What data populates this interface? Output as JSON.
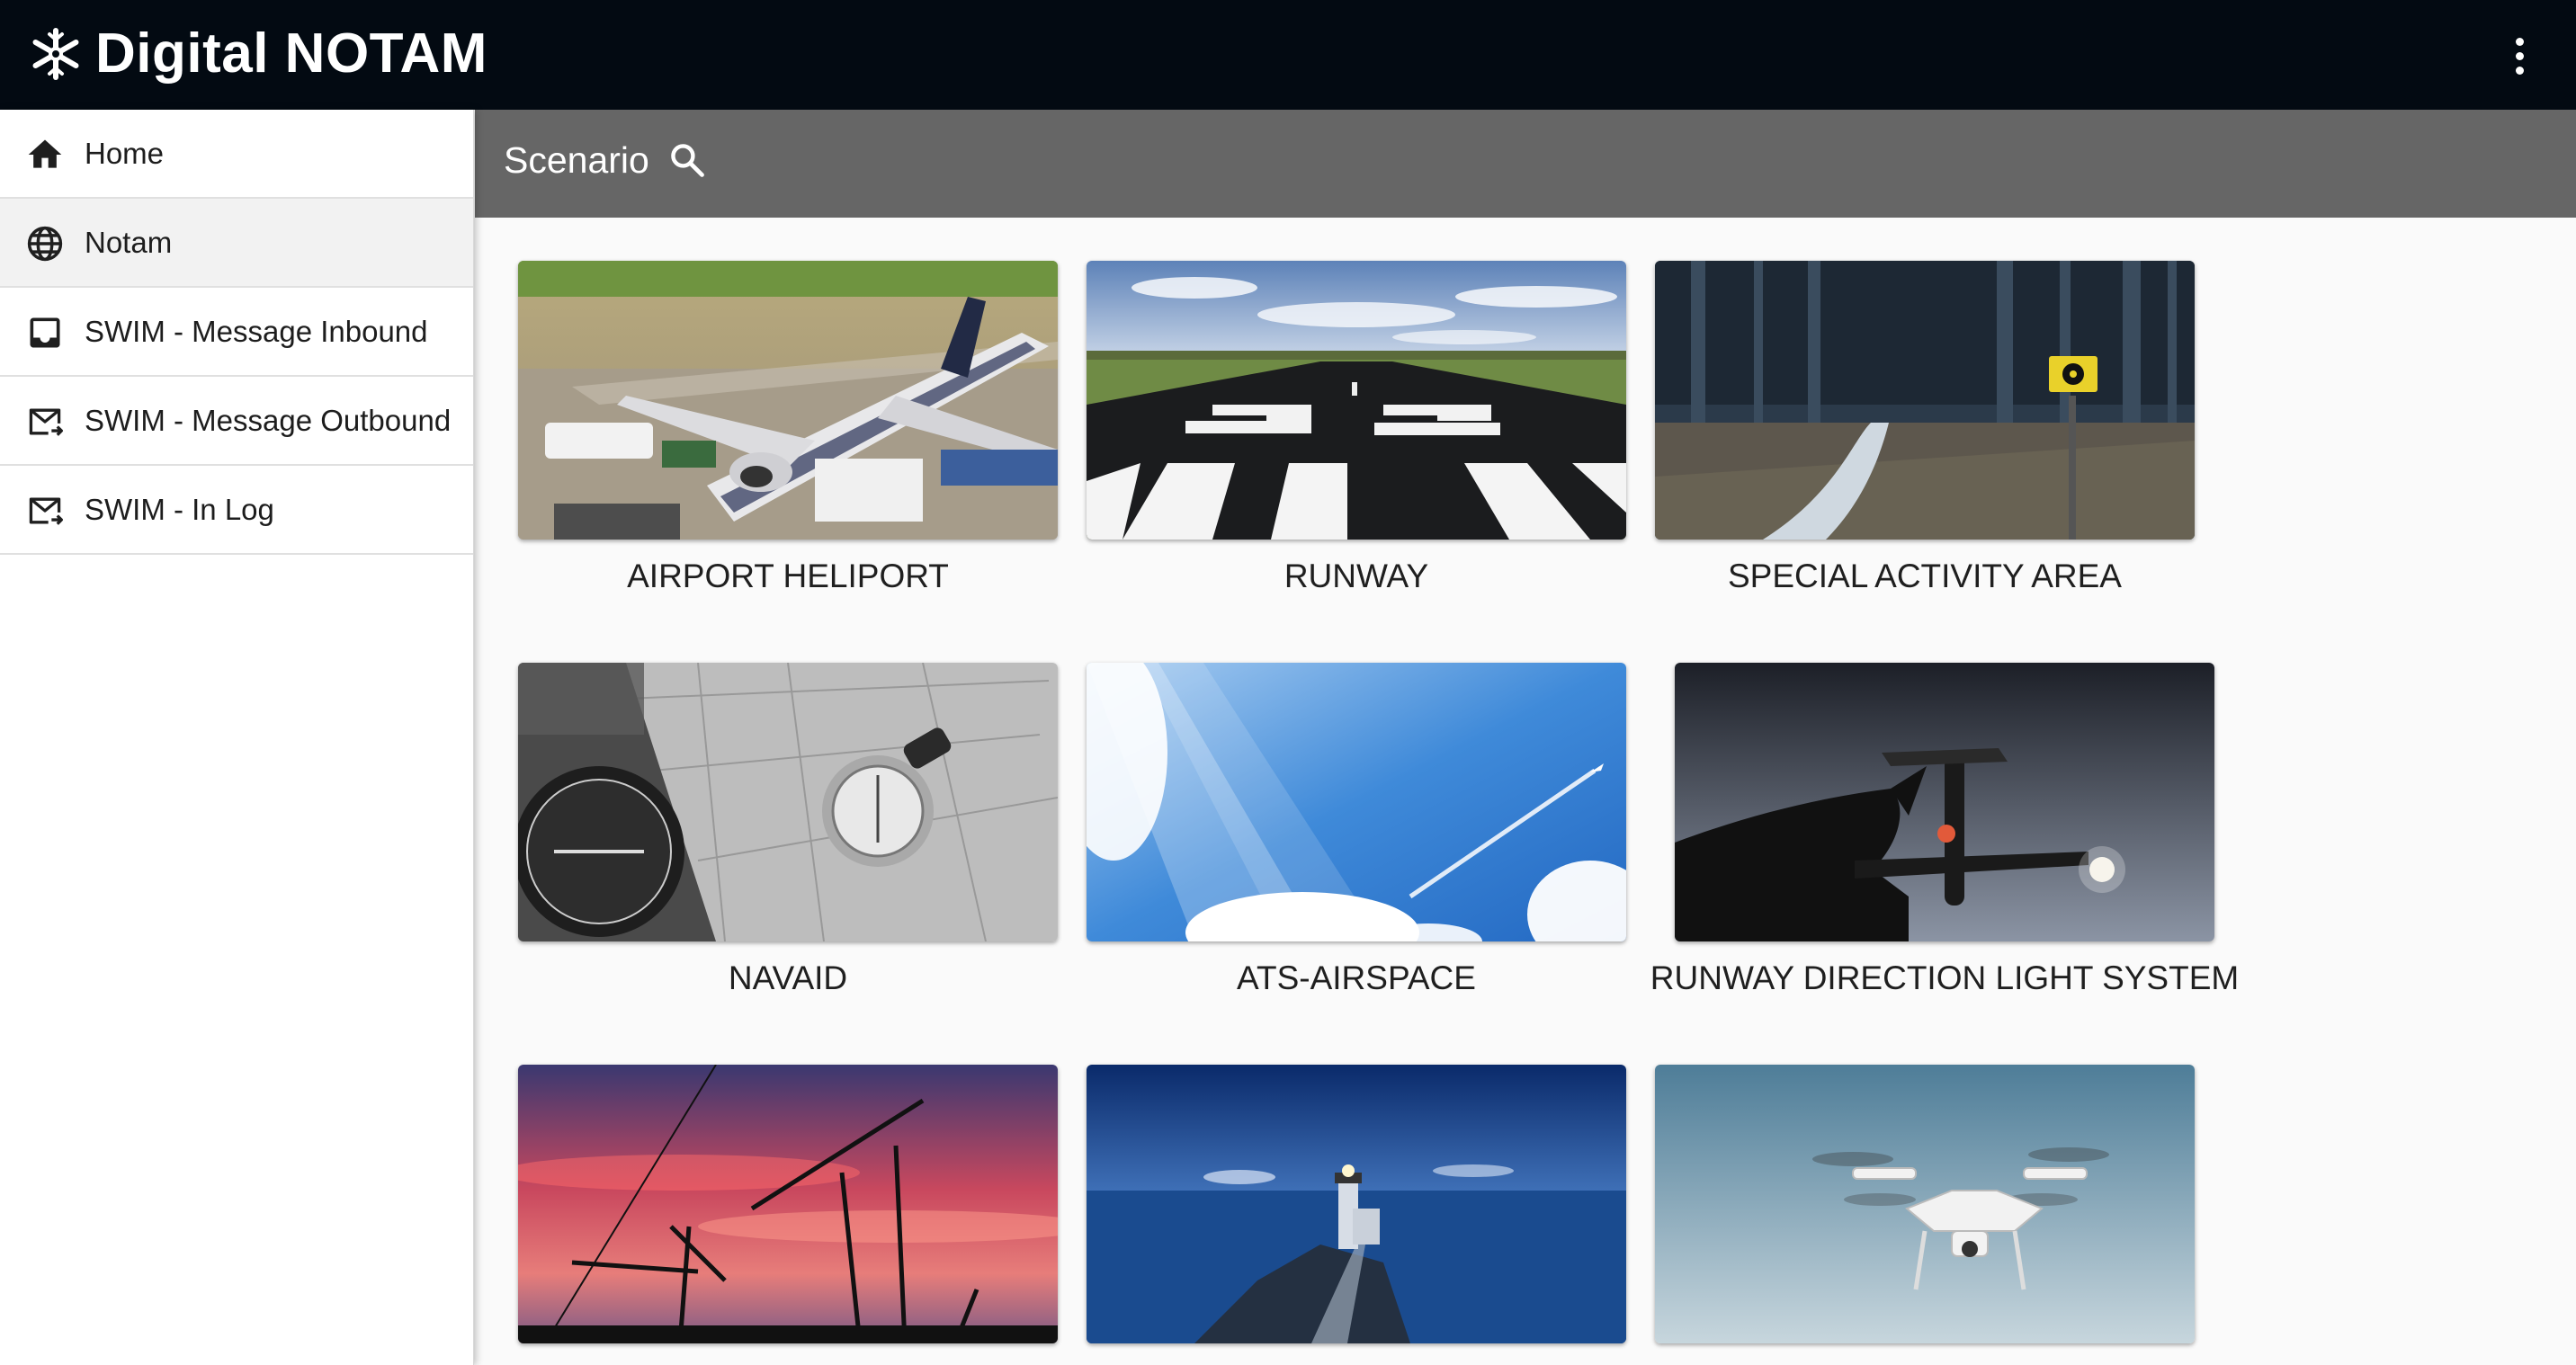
{
  "header": {
    "app_title": "Digital NOTAM",
    "logo_icon": "snowflake-logo-icon",
    "menu_icon": "more-vertical-icon",
    "background_color": "#030a12"
  },
  "sidebar": {
    "items": [
      {
        "label": "Home",
        "icon": "home-icon",
        "active": false
      },
      {
        "label": "Notam",
        "icon": "globe-icon",
        "active": true
      },
      {
        "label": "SWIM - Message Inbound",
        "icon": "inbox-icon",
        "active": false
      },
      {
        "label": "SWIM - Message Outbound",
        "icon": "mail-outbound-icon",
        "active": false
      },
      {
        "label": "SWIM - In Log",
        "icon": "mail-log-icon",
        "active": false
      }
    ]
  },
  "scenario": {
    "title": "Scenario",
    "search_icon": "search-icon",
    "bar_color": "#666666"
  },
  "cards": [
    {
      "label": "AIRPORT HELIPORT",
      "image": "airplane-at-gate-photo"
    },
    {
      "label": "RUNWAY",
      "image": "runway-markings-photo"
    },
    {
      "label": "SPECIAL ACTIVITY AREA",
      "image": "forest-road-radiation-sign-photo"
    },
    {
      "label": "NAVAID",
      "image": "compass-on-map-photo"
    },
    {
      "label": "ATS-AIRSPACE",
      "image": "blue-sky-contrail-photo"
    },
    {
      "label": "RUNWAY DIRECTION LIGHT SYSTEM",
      "image": "hand-airplane-silhouette-photo"
    },
    {
      "label": "",
      "image": "construction-cranes-sunset-photo"
    },
    {
      "label": "",
      "image": "lighthouse-blue-sea-photo"
    },
    {
      "label": "",
      "image": "drone-in-sky-photo"
    }
  ]
}
